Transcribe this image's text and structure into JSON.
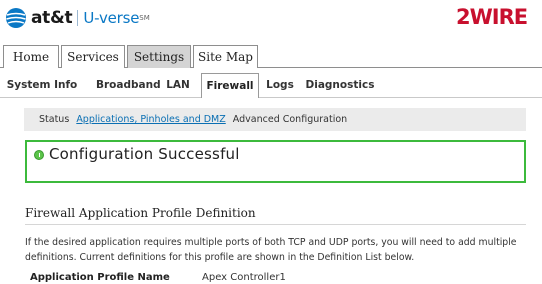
{
  "header": {
    "brand_att": "at&t",
    "brand_uverse": "U-verse",
    "brand_tm": "SM",
    "vendor_logo": "2WIRE",
    "vendor_color": "#c8102e"
  },
  "main_tabs": [
    {
      "label": "Home",
      "active": false
    },
    {
      "label": "Services",
      "active": false
    },
    {
      "label": "Settings",
      "active": true
    },
    {
      "label": "Site Map",
      "active": false
    }
  ],
  "sub_tabs": [
    {
      "label": "System Info",
      "active": false
    },
    {
      "label": "Broadband",
      "active": false
    },
    {
      "label": "LAN",
      "active": false
    },
    {
      "label": "Firewall",
      "active": true
    },
    {
      "label": "Logs",
      "active": false
    },
    {
      "label": "Diagnostics",
      "active": false
    }
  ],
  "crumbs": [
    {
      "label": "Status",
      "active": false
    },
    {
      "label": "Applications, Pinholes and DMZ",
      "active": true
    },
    {
      "label": "Advanced Configuration",
      "active": false
    }
  ],
  "success": {
    "message": "Configuration Successful",
    "status_color": "#3cba3c",
    "icon": "success-icon"
  },
  "section": {
    "title": "Firewall Application Profile Definition",
    "description": "If the desired application requires multiple ports of both TCP and UDP ports, you will need to add multiple definitions. Current definitions for this profile are shown in the Definition List below."
  },
  "form": {
    "profile_name_label": "Application Profile Name",
    "profile_name_value": "Apex Controller1"
  }
}
